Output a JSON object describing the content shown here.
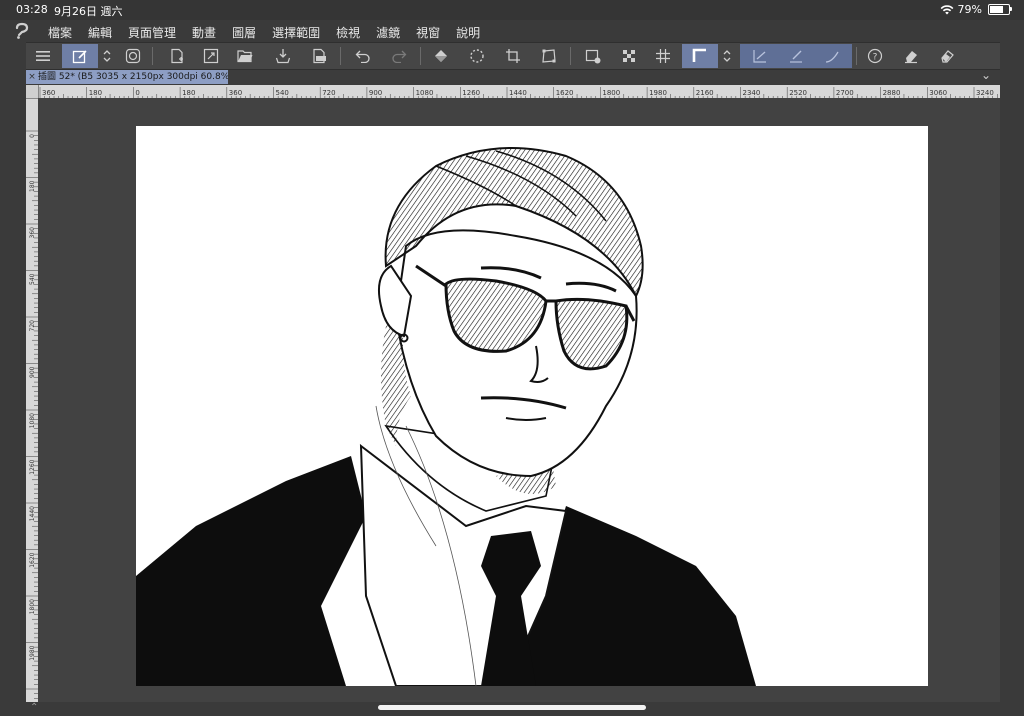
{
  "status": {
    "time": "03:28",
    "date": "9月26日 週六",
    "battery_text": "79%",
    "battery_level": 0.79,
    "wifi_icon": "wifi-icon"
  },
  "menu": {
    "items": [
      "檔案",
      "編輯",
      "頁面管理",
      "動畫",
      "圖層",
      "選擇範圍",
      "檢視",
      "濾鏡",
      "視窗",
      "說明"
    ]
  },
  "toolbar": {
    "icons": [
      "menu-icon",
      "edit-layer-icon",
      "up-down-icon",
      "spiral-icon",
      "new-page-icon",
      "resize-icon",
      "open-folder-icon",
      "import-icon",
      "export-png-icon",
      "undo-icon",
      "redo-icon",
      "fill-icon",
      "lasso-icon",
      "crop-icon",
      "transform-icon",
      "add-frame-icon",
      "checker-icon",
      "grid-icon",
      "corner-ruler-icon",
      "up-down-icon",
      "pen-stroke-icon",
      "pen-stroke-2-icon",
      "pen-stroke-3-icon",
      "help-icon",
      "eraser-icon",
      "eraser-2-icon"
    ]
  },
  "document": {
    "tab_title": "插圖 52* (B5 3035 x 2150px 300dpi 60.8%)"
  },
  "ruler": {
    "top_labels": [
      "360",
      "180",
      "0",
      "180",
      "360",
      "540",
      "720",
      "900",
      "1080",
      "1260",
      "1440",
      "1620",
      "1800",
      "1980",
      "2160",
      "2340",
      "2520",
      "2700",
      "2880",
      "3060",
      "3240"
    ],
    "left_labels": [
      "0",
      "180",
      "360",
      "540",
      "720",
      "900",
      "1080",
      "1260",
      "1440",
      "1620",
      "1800",
      "1980"
    ]
  },
  "colors": {
    "accent": "#6f7fa6",
    "tab": "#8d9ec4",
    "background": "#424242"
  }
}
